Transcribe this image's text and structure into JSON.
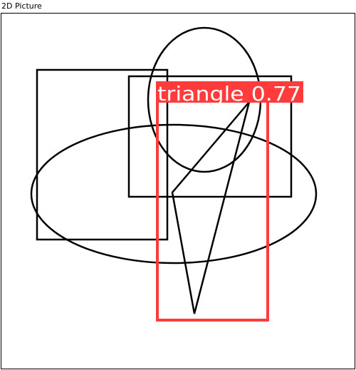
{
  "window": {
    "title": "2D Picture"
  },
  "canvas": {
    "background": "#ffffff",
    "shape_color": "#000000",
    "shapes": [
      "rectangle",
      "rectangle",
      "ellipse",
      "circle",
      "triangle"
    ]
  },
  "detection": {
    "class_name": "triangle",
    "confidence": "0.77",
    "label": "triangle 0.77",
    "color": "#ff3b3b",
    "label_text_color": "#ffffff"
  }
}
